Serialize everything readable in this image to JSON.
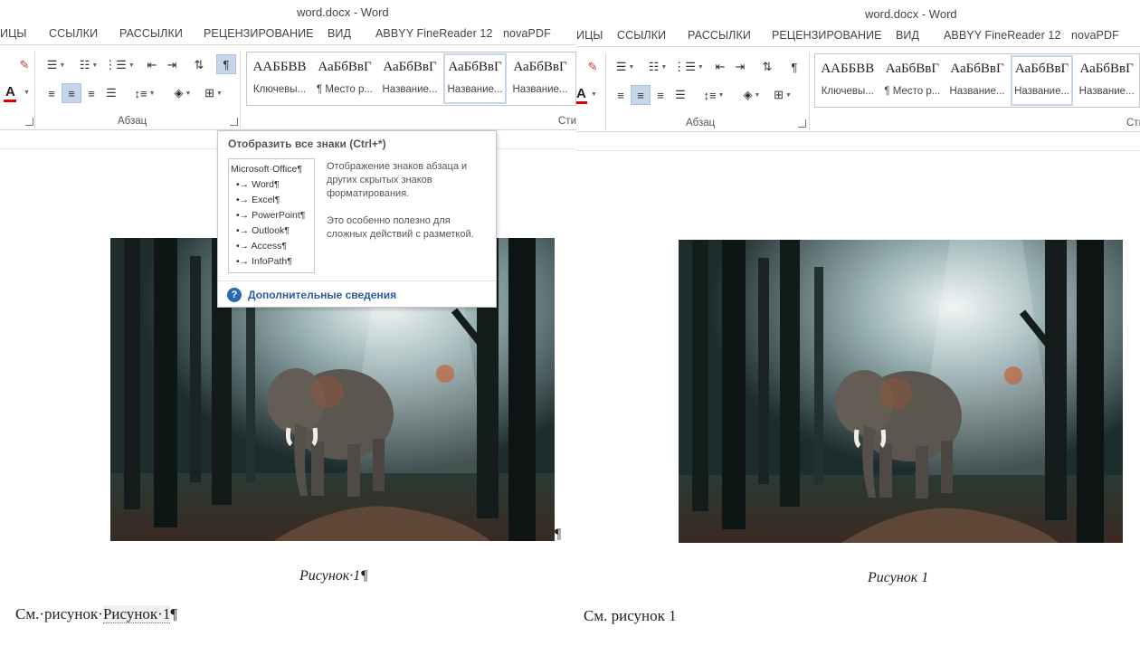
{
  "window": {
    "title": "word.docx - Word"
  },
  "ribbon": {
    "tabs": [
      "ИЦЫ",
      "ССЫЛКИ",
      "РАССЫЛКИ",
      "РЕЦЕНЗИРОВАНИЕ",
      "ВИД",
      "ABBYY FineReader 12",
      "novaPDF"
    ],
    "group_paragraph": "Абзац",
    "group_styles_cut": "Сти",
    "styles": [
      {
        "sample": "ААББВВ",
        "name": "Ключевы..."
      },
      {
        "sample": "АаБбВвГ",
        "name": "¶ Место р..."
      },
      {
        "sample": "АаБбВвГ",
        "name": "Название..."
      },
      {
        "sample": "АаБбВвГ",
        "name": "Название..."
      },
      {
        "sample": "АаБбВвГ",
        "name": "Название..."
      }
    ],
    "selected_style_index": 3
  },
  "tooltip": {
    "title": "Отобразить все знаки (Ctrl+*)",
    "example_header": "Microsoft·Office¶",
    "example_items": [
      "Word¶",
      "Excel¶",
      "PowerPoint¶",
      "Outlook¶",
      "Access¶",
      "InfoPath¶"
    ],
    "description_1": "Отображение знаков абзаца и других скрытых знаков форматирования.",
    "description_2": "Это особенно полезно для сложных действий с разметкой.",
    "link": "Дополнительные сведения"
  },
  "document_left": {
    "caption": "Рисунок·1¶",
    "text_prefix": "См.·рисунок·",
    "text_field": "Рисунок·1",
    "text_suffix": "¶",
    "image_pilcrow": "¶"
  },
  "document_right": {
    "caption": "Рисунок 1",
    "text": "См. рисунок 1"
  },
  "icons": {
    "show_marks": "pilcrow-icon",
    "bullets": "bullets-icon",
    "numbering": "numbering-icon",
    "multilevel": "multilevel-list-icon",
    "decrease_indent": "decrease-indent-icon",
    "increase_indent": "increase-indent-icon",
    "sort": "sort-icon",
    "align_left": "align-left-icon",
    "center": "align-center-icon",
    "align_right": "align-right-icon",
    "justify": "justify-icon",
    "line_spacing": "line-spacing-icon",
    "shading": "shading-icon",
    "borders": "borders-icon",
    "help": "help-icon"
  },
  "colors": {
    "font_color": "#d00000",
    "selected_bg": "#c5d5ea",
    "link": "#2a5a9a"
  }
}
